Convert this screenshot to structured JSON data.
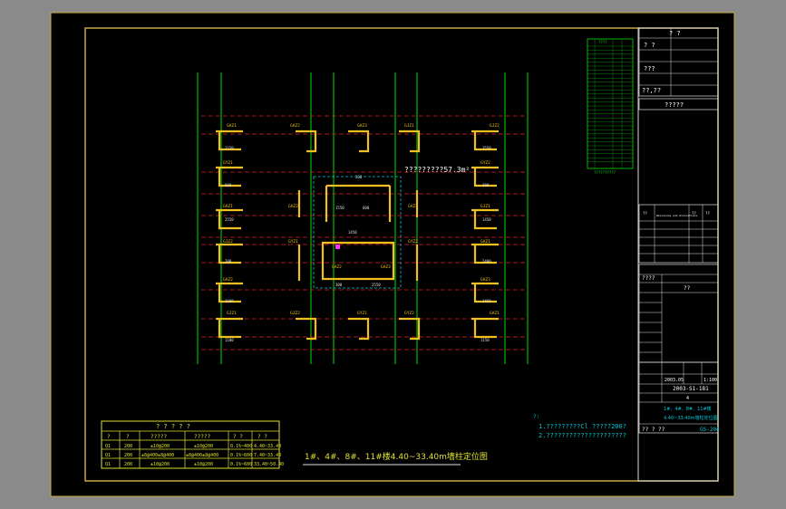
{
  "drawing": {
    "title": "1#、4#、8#、11#楼4.40~33.40m墙柱定位图",
    "area_note": "?????????57.3m²",
    "colors": {
      "background": "#000000",
      "frame": "#c8a848",
      "grid_axis": "#00e000",
      "grid_line": "#e02020",
      "wall": "#f0c020",
      "dim": "#e0e0e0",
      "table": "#e0e030",
      "cyan": "#00c8d8",
      "magenta": "#ff30ff",
      "white": "#ffffff",
      "outer": "#8a8a8a"
    },
    "column_labels": [
      "GAZ1",
      "GAZ2",
      "GAZ3",
      "GJZ1",
      "GJZ2",
      "GYZ1",
      "GYZ2"
    ],
    "dim_labels": [
      "1150",
      "1550",
      "600",
      "300",
      "2550",
      "1450",
      "200",
      "2400",
      "1600",
      "3450",
      "1100"
    ]
  },
  "notes": {
    "header": "?:",
    "line1": "1.?????????Cl ?????200?",
    "line2": "2.?????????????????????"
  },
  "legend_table": {
    "title": "? ? ? ? ?",
    "headers": [
      "?",
      "?",
      "?????",
      "?????",
      "? ?",
      "? ?"
    ],
    "rows": [
      [
        "Q1",
        "200",
        "±10@200",
        "±10@200",
        "0.1%~400",
        "4.40~33.40"
      ],
      [
        "Q1",
        "200",
        "±8@400±8@400",
        "±8@400±8@400",
        "0.1%~600",
        "7.40~33.40"
      ],
      [
        "Q1",
        "200",
        "±10@200",
        "±10@200",
        "0.1%~600",
        "33.40~50.40"
      ]
    ]
  },
  "level_table": {
    "header": [
      "??",
      "????",
      "??",
      "??"
    ],
    "rows_count_label": "30",
    "footer": "??????????"
  },
  "title_block": {
    "row1": "? ?",
    "row2": "? ?",
    "row3": "???",
    "row4": "??,??",
    "project": "?????",
    "rev_headers": [
      "??",
      "Revisions and Alterations",
      "??",
      "??"
    ],
    "design_label": "????",
    "approve_label": "??",
    "sheet_no": "2003-S1-181",
    "date": "2003.05",
    "scale": "1:100",
    "version": "4",
    "sheet_title_1": "1#、4#、8#、11#楼",
    "sheet_title_2": "4.40~33.40m墙柱定位图",
    "drawing_no": "GS-204",
    "sheet_total": "?? ? ??"
  }
}
